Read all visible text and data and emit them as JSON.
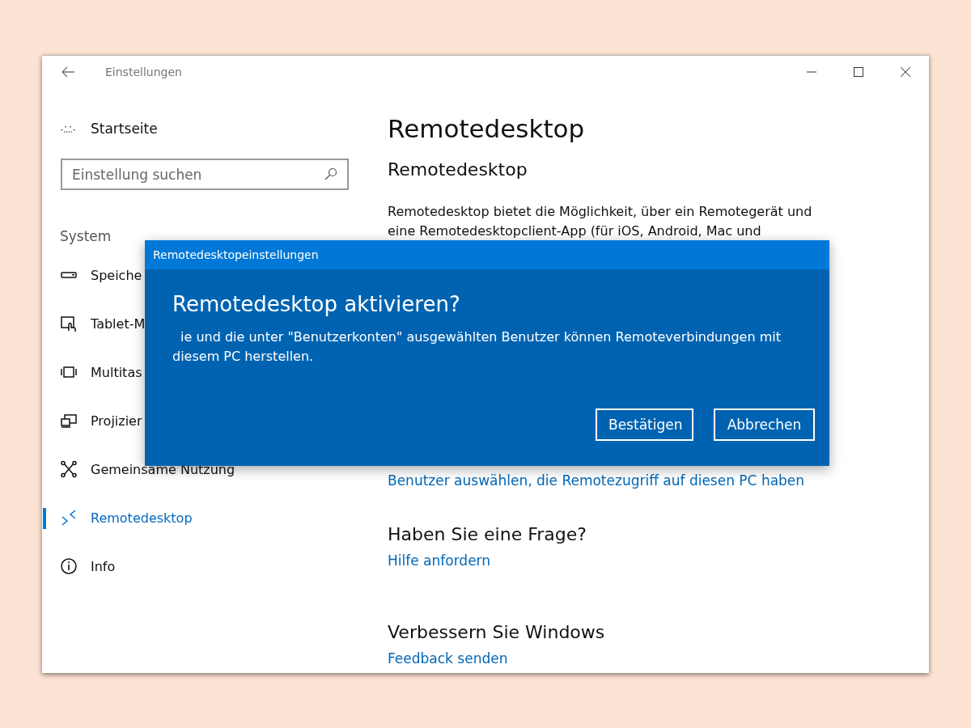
{
  "window": {
    "title": "Einstellungen"
  },
  "sidebar": {
    "home": "Startseite",
    "search": {
      "placeholder": "Einstellung suchen"
    },
    "section": "System",
    "items": [
      {
        "label": "Speiche",
        "selected": false
      },
      {
        "label": "Tablet-M",
        "selected": false
      },
      {
        "label": "Multitas",
        "selected": false
      },
      {
        "label": "Projizier",
        "selected": false
      },
      {
        "label": "Gemeinsame Nutzung",
        "selected": false
      },
      {
        "label": "Remotedesktop",
        "selected": true
      },
      {
        "label": "Info",
        "selected": false
      }
    ]
  },
  "content": {
    "title": "Remotedesktop",
    "subtitle": "Remotedesktop",
    "description": [
      "Remotedesktop bietet die Möglichkeit, über ein Remotegerät und",
      "eine Remotedesktopclient-App (für iOS, Android, Mac und"
    ],
    "link": "Benutzer auswählen, die Remotezugriff auf diesen PC haben",
    "sections": [
      {
        "heading": "Haben Sie eine Frage?",
        "link": "Hilfe anfordern"
      },
      {
        "heading": "Verbessern Sie Windows",
        "link": "Feedback senden"
      }
    ]
  },
  "dialog": {
    "title": "Remotedesktopeinstellungen",
    "heading": "Remotedesktop aktivieren?",
    "message": "ie und die unter \"Benutzerkonten\" ausgewählten Benutzer können Remoteverbindungen mit diesem PC herstellen.",
    "buttons": [
      "Bestätigen",
      "Abbrechen"
    ]
  }
}
